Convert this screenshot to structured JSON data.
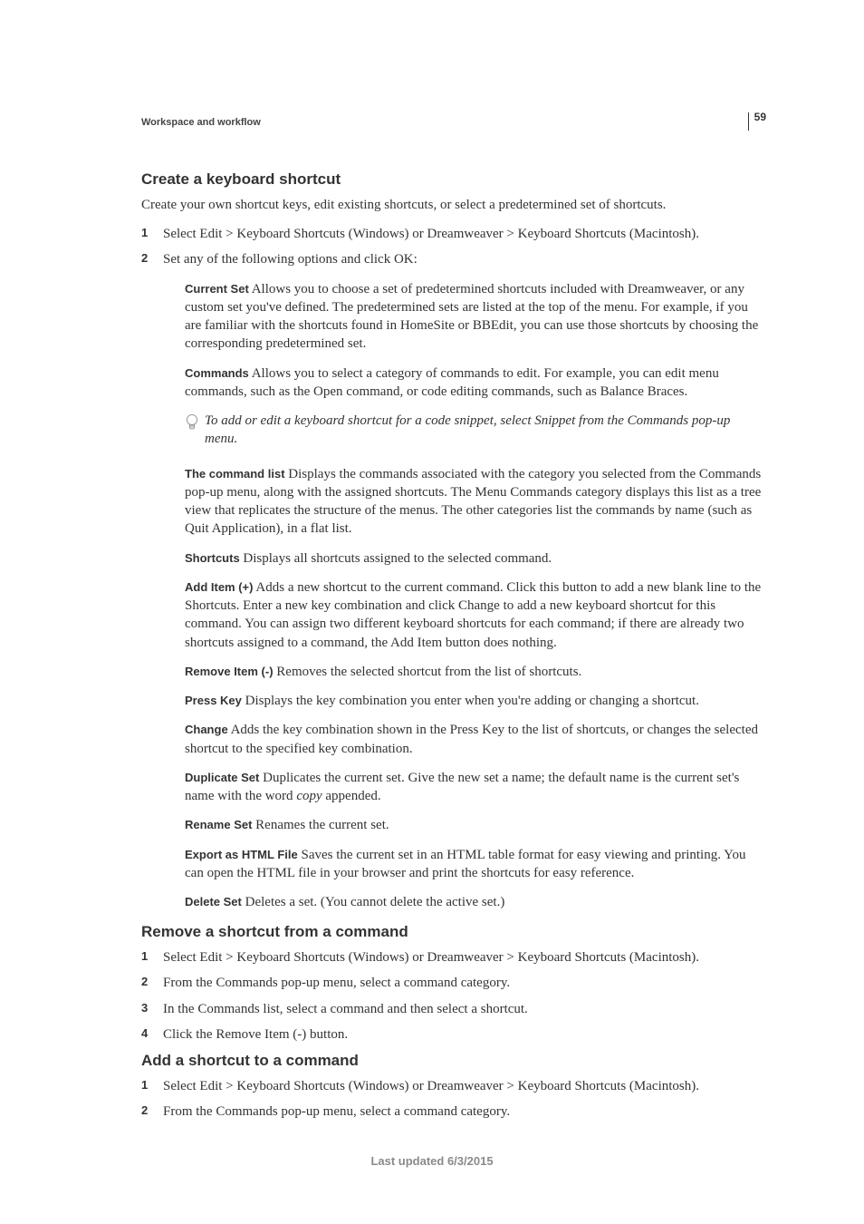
{
  "page_number": "59",
  "breadcrumb": "Workspace and workflow",
  "sec1": {
    "title": "Create a keyboard shortcut",
    "intro": "Create your own shortcut keys, edit existing shortcuts, or select a predetermined set of shortcuts.",
    "step1": "Select Edit > Keyboard Shortcuts (Windows) or Dreamweaver > Keyboard Shortcuts (Macintosh).",
    "step2": "Set any of the following options and click OK:",
    "defs": {
      "current_set_label": "Current Set",
      "current_set_text": "  Allows you to choose a set of predetermined shortcuts included with Dreamweaver, or any custom set you've defined. The predetermined sets are listed at the top of the menu. For example, if you are familiar with the shortcuts found in HomeSite or BBEdit, you can use those shortcuts by choosing the corresponding predetermined set.",
      "commands_label": "Commands",
      "commands_text": "  Allows you to select a category of commands to edit. For example, you can edit menu commands, such as the Open command, or code editing commands, such as Balance Braces.",
      "tip": "To add or edit a keyboard shortcut for a code snippet, select Snippet from the Commands pop-up menu.",
      "command_list_label": "The command list",
      "command_list_text": "  Displays the commands associated with the category you selected from the Commands pop-up menu, along with the assigned shortcuts. The Menu Commands category displays this list as a tree view that replicates the structure of the menus. The other categories list the commands by name (such as Quit Application), in a flat list.",
      "shortcuts_label": "Shortcuts",
      "shortcuts_text": "  Displays all shortcuts assigned to the selected command.",
      "add_item_label": "Add Item (+)",
      "add_item_text": "  Adds a new shortcut to the current command. Click this button to add a new blank line to the Shortcuts. Enter a new key combination and click Change to add a new keyboard shortcut for this command. You can assign two different keyboard shortcuts for each command; if there are already two shortcuts assigned to a command, the Add Item button does nothing.",
      "remove_item_label": "Remove Item (-)",
      "remove_item_text": "  Removes the selected shortcut from the list of shortcuts.",
      "press_key_label": "Press Key",
      "press_key_text": "  Displays the key combination you enter when you're adding or changing a shortcut.",
      "change_label": "Change",
      "change_text": "  Adds the key combination shown in the Press Key to the list of shortcuts, or changes the selected shortcut to the specified key combination.",
      "duplicate_set_label": "Duplicate Set",
      "duplicate_set_text_a": "  Duplicates the current set. Give the new set a name; the default name is the current set's name with the word ",
      "duplicate_set_text_b": "copy",
      "duplicate_set_text_c": " appended.",
      "rename_set_label": "Rename Set",
      "rename_set_text": "  Renames the current set.",
      "export_label": "Export as HTML File",
      "export_text": "  Saves the current set in an HTML table format for easy viewing and printing. You can open the HTML file in your browser and print the shortcuts for easy reference.",
      "delete_set_label": "Delete Set",
      "delete_set_text": "  Deletes a set. (You cannot delete the active set.)"
    }
  },
  "sec2": {
    "title": "Remove a shortcut from a command",
    "step1": "Select Edit > Keyboard Shortcuts (Windows) or Dreamweaver > Keyboard Shortcuts (Macintosh).",
    "step2": "From the Commands pop-up menu, select a command category.",
    "step3": "In the Commands list, select a command and then select a shortcut.",
    "step4": "Click the Remove Item (-) button."
  },
  "sec3": {
    "title": "Add a shortcut to a command",
    "step1": "Select Edit > Keyboard Shortcuts (Windows) or Dreamweaver > Keyboard Shortcuts (Macintosh).",
    "step2": "From the Commands pop-up menu, select a command category."
  },
  "footer": "Last updated 6/3/2015"
}
